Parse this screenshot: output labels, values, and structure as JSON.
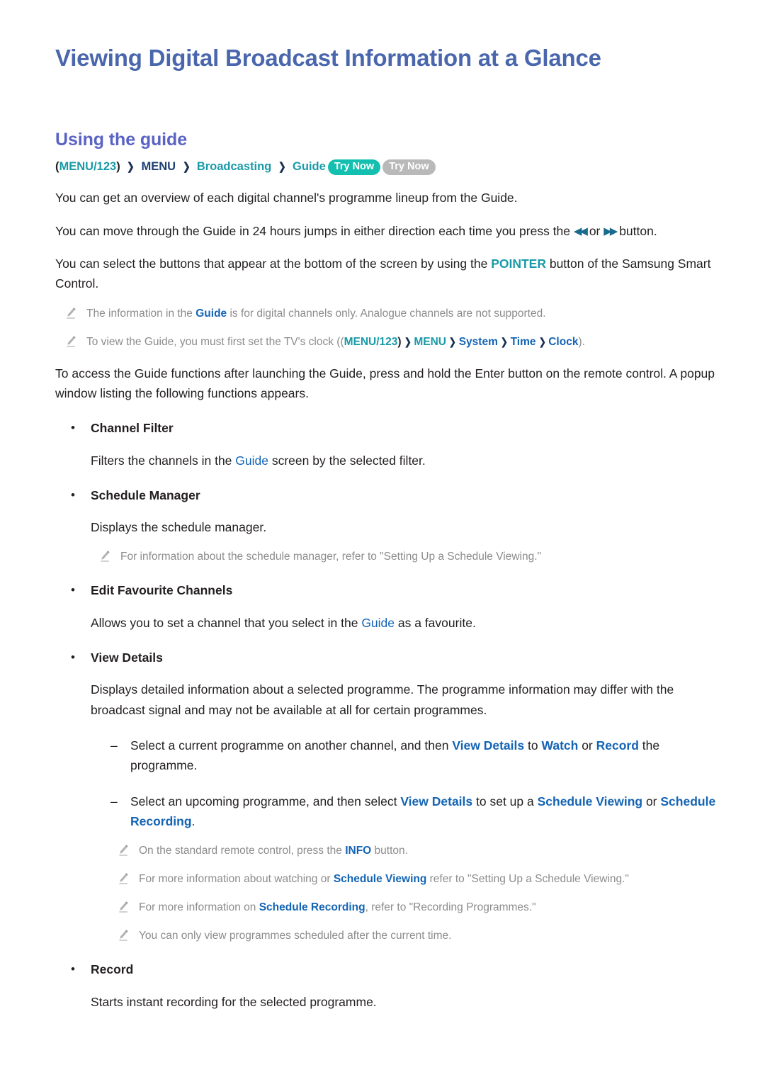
{
  "document": {
    "title": "Viewing Digital Broadcast Information at a Glance",
    "section_title": "Using the guide"
  },
  "breadcrumb": {
    "open_paren": "(",
    "menu123": "MENU/123",
    "close_paren": ")",
    "chevron": "❯",
    "menu": "MENU",
    "broadcasting": "Broadcasting",
    "guide": "Guide",
    "try_now_primary": "Try Now",
    "try_now_secondary": "Try Now"
  },
  "intro": {
    "p1": "You can get an overview of each digital channel's programme lineup from the Guide.",
    "p2_a": "You can move through the Guide in 24 hours jumps in either direction each time you press the ",
    "p2_rewind_icon": "rewind-icon",
    "p2_b": " or ",
    "p2_forward_icon": "fast-forward-icon",
    "p2_c": " button.",
    "p3_a": "You can select the buttons that appear at the bottom of the screen by using the ",
    "p3_pointer": "POINTER",
    "p3_b": " button of the Samsung Smart Control."
  },
  "notes_top": [
    {
      "a": "The information in the ",
      "link": "Guide",
      "b": " is for digital channels only. Analogue channels are not supported."
    }
  ],
  "note_clock": {
    "a": "To view the Guide, you must first set the TV's clock ((",
    "menu123": "MENU/123",
    "close_paren": ")",
    "chevron": "❯",
    "menu": "MENU",
    "system": "System",
    "time": "Time",
    "clock": "Clock",
    "b": ")."
  },
  "access": {
    "paragraph": "To access the Guide functions after launching the Guide, press and hold the Enter button on the remote control. A popup window listing the following functions appears."
  },
  "functions": [
    {
      "label": "Channel Filter",
      "desc_a": "Filters the channels in the ",
      "desc_link": "Guide",
      "desc_b": " screen by the selected filter."
    },
    {
      "label": "Schedule Manager",
      "desc_a": "Displays the schedule manager.",
      "desc_link": "",
      "desc_b": ""
    },
    {
      "label": "Edit Favourite Channels",
      "desc_a": "Allows you to set a channel that you select in the ",
      "desc_link": "Guide",
      "desc_b": " as a favourite."
    },
    {
      "label": "View Details",
      "desc_a": "Displays detailed information about a selected programme. The programme information may differ with the broadcast signal and may not be available at all for certain programmes.",
      "desc_link": "",
      "desc_b": ""
    },
    {
      "label": "Record",
      "desc_a": "Starts instant recording for the selected programme.",
      "desc_link": "",
      "desc_b": ""
    }
  ],
  "schedule_manager_note": {
    "text": "For information about the schedule manager, refer to \"Setting Up a Schedule Viewing.\""
  },
  "view_details_dashes": [
    {
      "a": "Select a current programme on another channel, and then ",
      "k1": "View Details",
      "b": " to ",
      "k2": "Watch",
      "c": " or ",
      "k3": "Record",
      "d": " the programme."
    },
    {
      "a": "Select an upcoming programme, and then select ",
      "k1": "View Details",
      "b": " to set up a ",
      "k2": "Schedule Viewing",
      "c": " or ",
      "k3": "Schedule Recording",
      "d": "."
    }
  ],
  "view_details_notes": [
    {
      "a": "On the standard remote control, press the ",
      "link": "INFO",
      "b": " button."
    },
    {
      "a": "For more information about watching or ",
      "link": "Schedule Viewing",
      "b": " refer to \"Setting Up a Schedule Viewing.\""
    },
    {
      "a": "For more information on ",
      "link": "Schedule Recording",
      "b": ", refer to \"Recording Programmes.\""
    },
    {
      "a": "You can only view programmes scheduled after the current time.",
      "link": "",
      "b": ""
    }
  ],
  "colors": {
    "title_blue": "#4a67ad",
    "section_purple": "#5a63c4",
    "link_blue": "#1464b4",
    "teal": "#1a9aa8",
    "pill_teal": "#13bfae",
    "pill_gray": "#b9b9b9",
    "note_gray": "#8c8c8c",
    "body_black": "#231f20"
  }
}
